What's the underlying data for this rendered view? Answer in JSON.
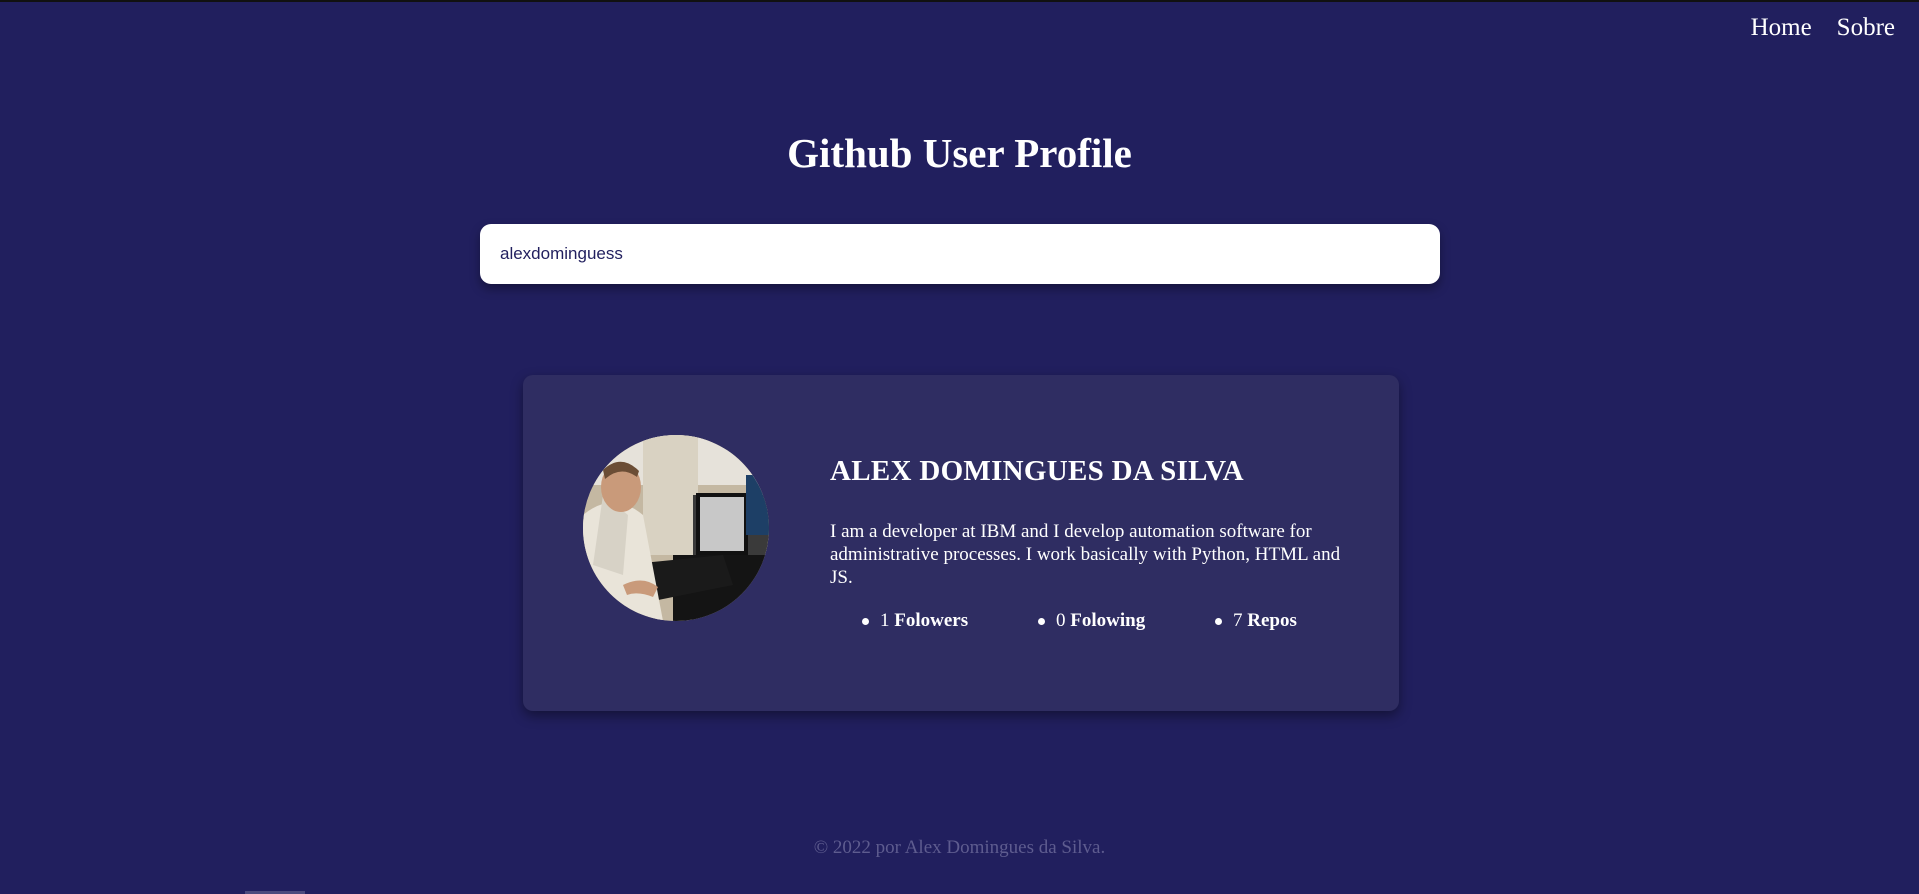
{
  "nav": {
    "home_label": "Home",
    "about_label": "Sobre"
  },
  "page": {
    "title": "Github User Profile"
  },
  "search": {
    "value": "alexdominguess"
  },
  "profile": {
    "name": "ALEX DOMINGUES DA SILVA",
    "bio": "I am a developer at IBM and I develop automation software for administrative processes. I work basically with Python, HTML and JS.",
    "stats": {
      "followers_count": "1",
      "followers_label": "Folowers",
      "following_count": "0",
      "following_label": "Folowing",
      "repos_count": "7",
      "repos_label": "Repos"
    }
  },
  "footer": {
    "text": "© 2022 por Alex Domingues da Silva."
  },
  "colors": {
    "background": "#211f5e",
    "card": "#2f2d62",
    "footer_text": "#5e5c8f"
  }
}
